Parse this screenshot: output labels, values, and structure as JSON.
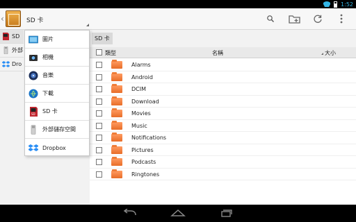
{
  "status_bar": {
    "time": "1:52",
    "wifi_icon": "wifi-icon",
    "battery_icon": "battery-icon",
    "accent_color": "#33b5e5"
  },
  "action_bar": {
    "title": "SD 卡",
    "back_icon": "chevron-left-icon",
    "app_icon": "cabinet-folder-icon",
    "actions": [
      {
        "name": "search-icon"
      },
      {
        "name": "new-folder-icon"
      },
      {
        "name": "refresh-icon"
      },
      {
        "name": "overflow-menu-icon"
      }
    ]
  },
  "left_list": {
    "items": [
      {
        "label": "SD",
        "icon": "sd-card-icon"
      },
      {
        "label": "外部",
        "icon": "usb-storage-icon"
      },
      {
        "label": "Dro",
        "icon": "dropbox-icon"
      }
    ]
  },
  "dropdown": {
    "items": [
      {
        "label": "圖片",
        "icon": "pictures-icon"
      },
      {
        "label": "相機",
        "icon": "camera-icon"
      },
      {
        "label": "音樂",
        "icon": "music-icon"
      },
      {
        "label": "下載",
        "icon": "download-icon"
      },
      {
        "label": "SD 卡",
        "icon": "sd-card-icon"
      },
      {
        "label": "外部儲存空間",
        "icon": "usb-storage-icon"
      },
      {
        "label": "Dropbox",
        "icon": "dropbox-icon"
      }
    ]
  },
  "breadcrumb": {
    "label": "SD 卡"
  },
  "table": {
    "headers": {
      "type": "類型",
      "name": "名稱",
      "size": "大小"
    },
    "rows": [
      {
        "name": "Alarms"
      },
      {
        "name": "Android"
      },
      {
        "name": "DCIM"
      },
      {
        "name": "Download"
      },
      {
        "name": "Movies"
      },
      {
        "name": "Music"
      },
      {
        "name": "Notifications"
      },
      {
        "name": "Pictures"
      },
      {
        "name": "Podcasts"
      },
      {
        "name": "Ringtones"
      }
    ]
  },
  "nav_bar": {
    "back_icon": "back-arrow-icon",
    "home_icon": "home-icon",
    "recents_icon": "recent-apps-icon"
  }
}
